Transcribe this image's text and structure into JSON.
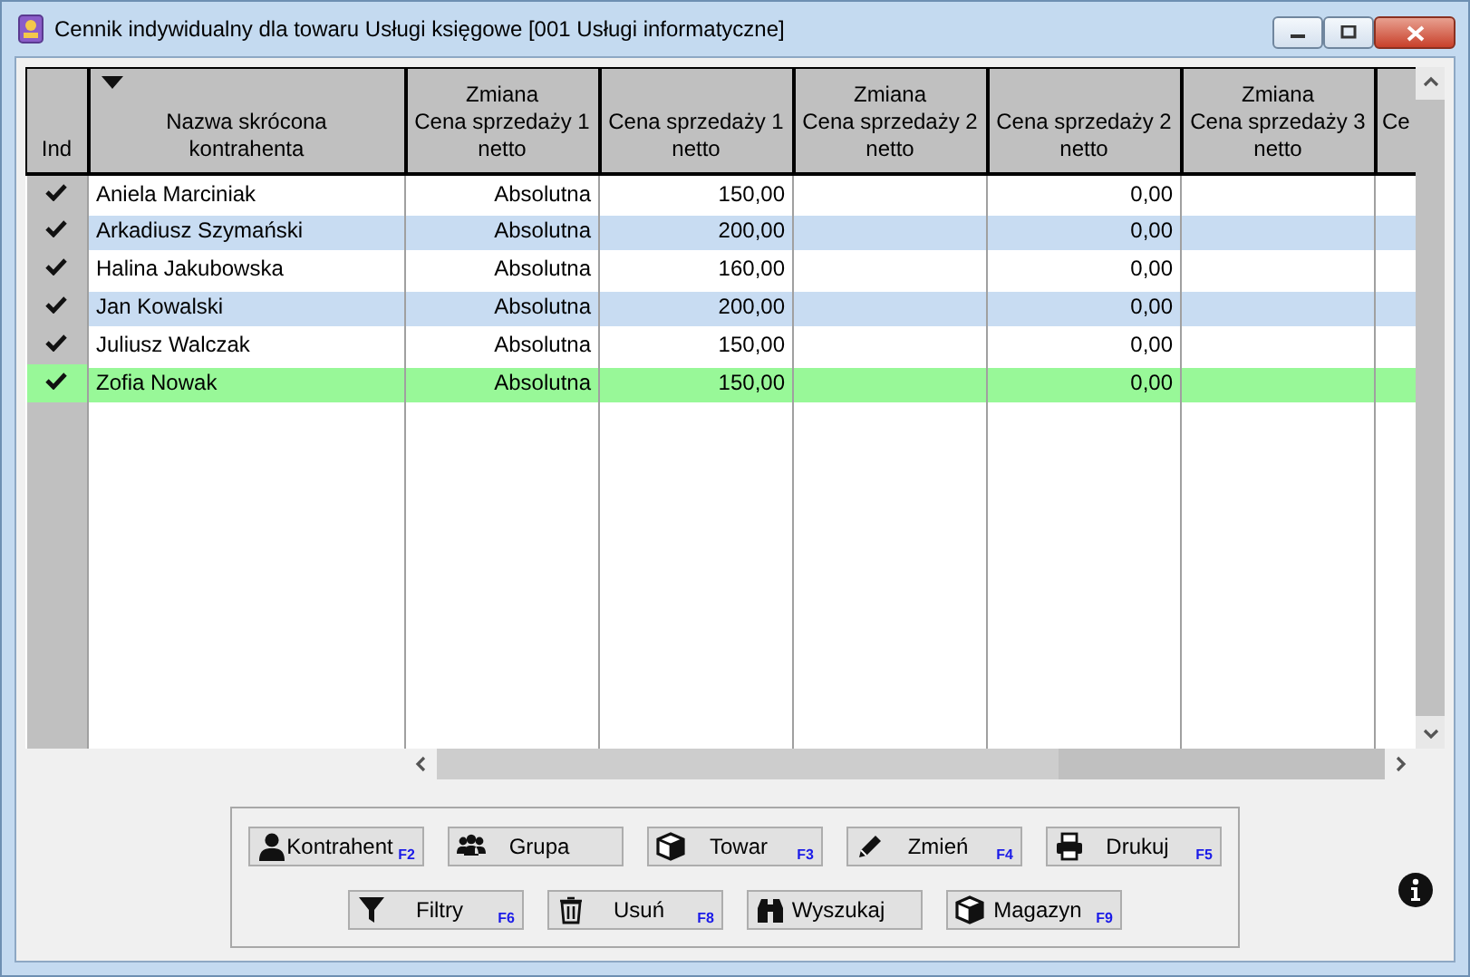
{
  "window": {
    "title": "Cennik indywidualny dla towaru Usługi księgowe [001 Usługi informatyczne]"
  },
  "table": {
    "columns": [
      {
        "label": "Ind",
        "sorted": false
      },
      {
        "label": "Nazwa skrócona\nkontrahenta",
        "sorted": true
      },
      {
        "label": "Zmiana\nCena sprzedaży 1\nnetto",
        "sorted": false
      },
      {
        "label": "Cena sprzedaży 1\nnetto",
        "sorted": false
      },
      {
        "label": "Zmiana\nCena sprzedaży 2\nnetto",
        "sorted": false
      },
      {
        "label": "Cena sprzedaży 2\nnetto",
        "sorted": false
      },
      {
        "label": "Zmiana\nCena sprzedaży 3\nnetto",
        "sorted": false
      },
      {
        "label": "Ce",
        "sorted": false
      }
    ],
    "rows": [
      {
        "ind": true,
        "name": "Aniela Marciniak",
        "change_1": "Absolutna",
        "price_1": "150,00",
        "price_2": "0,00",
        "selected": false
      },
      {
        "ind": true,
        "name": "Arkadiusz Szymański",
        "change_1": "Absolutna",
        "price_1": "200,00",
        "price_2": "0,00",
        "selected": false
      },
      {
        "ind": true,
        "name": "Halina Jakubowska",
        "change_1": "Absolutna",
        "price_1": "160,00",
        "price_2": "0,00",
        "selected": false
      },
      {
        "ind": true,
        "name": "Jan Kowalski",
        "change_1": "Absolutna",
        "price_1": "200,00",
        "price_2": "0,00",
        "selected": false
      },
      {
        "ind": true,
        "name": "Juliusz Walczak",
        "change_1": "Absolutna",
        "price_1": "150,00",
        "price_2": "0,00",
        "selected": false
      },
      {
        "ind": true,
        "name": "Zofia Nowak",
        "change_1": "Absolutna",
        "price_1": "150,00",
        "price_2": "0,00",
        "selected": true
      }
    ]
  },
  "buttons": [
    [
      {
        "label": "Kontrahent",
        "key": "F2"
      },
      {
        "label": "Grupa"
      },
      {
        "label": "Towar",
        "key": "F3"
      },
      {
        "label": "Zmień",
        "key": "F4"
      },
      {
        "label": "Drukuj",
        "key": "F5"
      }
    ],
    [
      {
        "label": "Filtry",
        "key": "F6"
      },
      {
        "label": "Usuń",
        "key": "F8"
      },
      {
        "label": "Wyszukaj"
      },
      {
        "label": "Magazyn",
        "key": "F9"
      }
    ]
  ]
}
